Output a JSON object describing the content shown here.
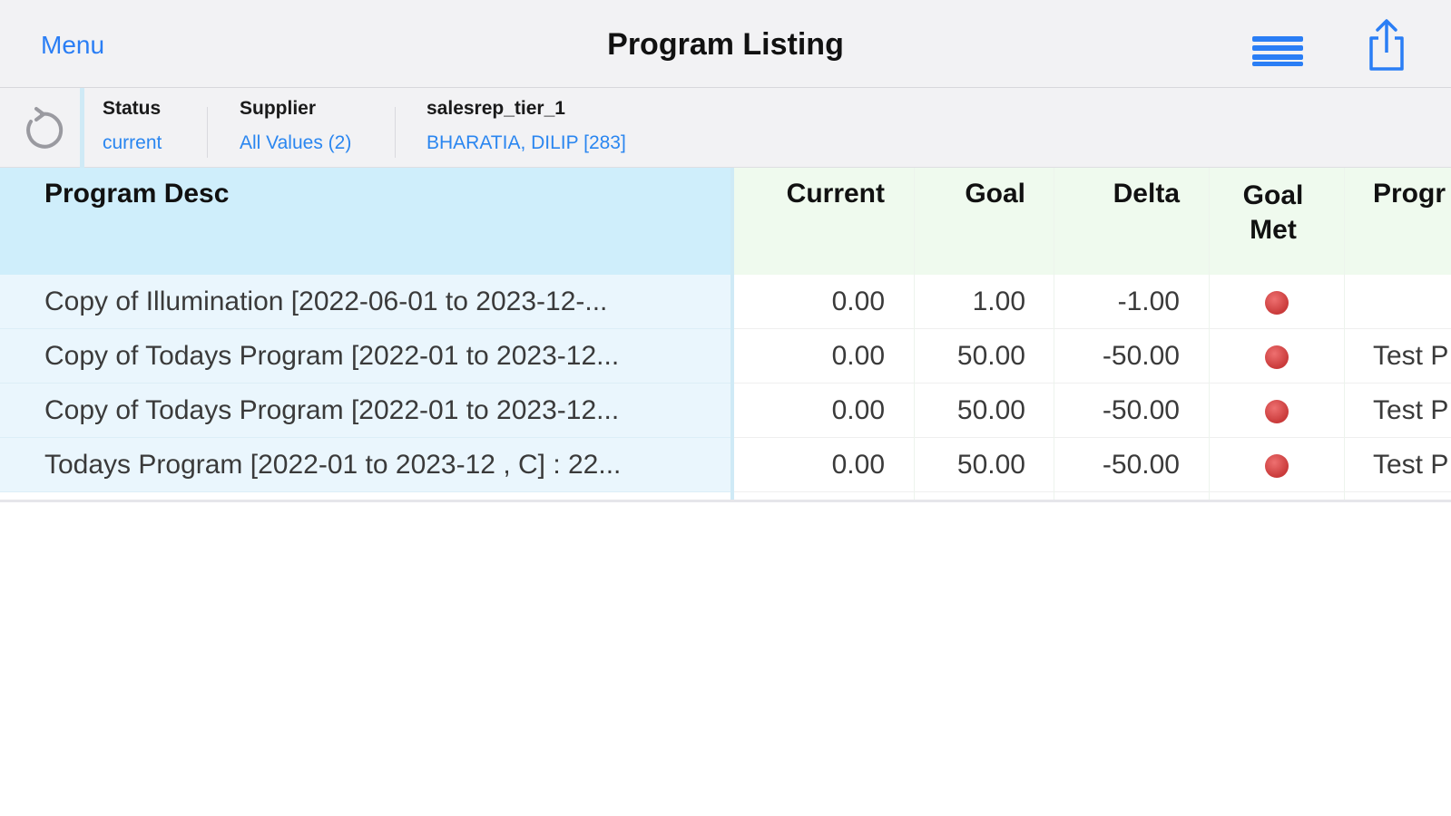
{
  "navbar": {
    "menu_label": "Menu",
    "title": "Program Listing",
    "list_icon": "list-icon",
    "share_icon": "share-icon",
    "accent_color": "#2a7ef5"
  },
  "filters": {
    "refresh_icon": "refresh-icon",
    "items": [
      {
        "label": "Status",
        "value": "current"
      },
      {
        "label": "Supplier",
        "value": "All Values (2)"
      },
      {
        "label": "salesrep_tier_1",
        "value": "BHARATIA, DILIP [283]"
      }
    ]
  },
  "table": {
    "headers": {
      "desc": "Program Desc",
      "current": "Current",
      "goal": "Goal",
      "delta": "Delta",
      "goal_met_line1": "Goal",
      "goal_met_line2": "Met",
      "program": "Progr"
    },
    "rows": [
      {
        "desc": "Copy  of Illumination [2022-06-01 to 2023-12-...",
        "current": "0.00",
        "goal": "1.00",
        "delta": "-1.00",
        "goal_met": "red",
        "program": ""
      },
      {
        "desc": "Copy  of Todays Program [2022-01 to 2023-12...",
        "current": "0.00",
        "goal": "50.00",
        "delta": "-50.00",
        "goal_met": "red",
        "program": "Test P"
      },
      {
        "desc": "Copy  of Todays Program [2022-01 to 2023-12...",
        "current": "0.00",
        "goal": "50.00",
        "delta": "-50.00",
        "goal_met": "red",
        "program": "Test P"
      },
      {
        "desc": "Todays Program [2022-01 to 2023-12 , C] : 22...",
        "current": "0.00",
        "goal": "50.00",
        "delta": "-50.00",
        "goal_met": "red",
        "program": "Test P"
      }
    ],
    "colors": {
      "desc_header_bg": "#cfeefb",
      "value_header_bg": "#effaee",
      "desc_row_bg": "#eaf6fd",
      "goal_not_met": "#d94646"
    }
  }
}
